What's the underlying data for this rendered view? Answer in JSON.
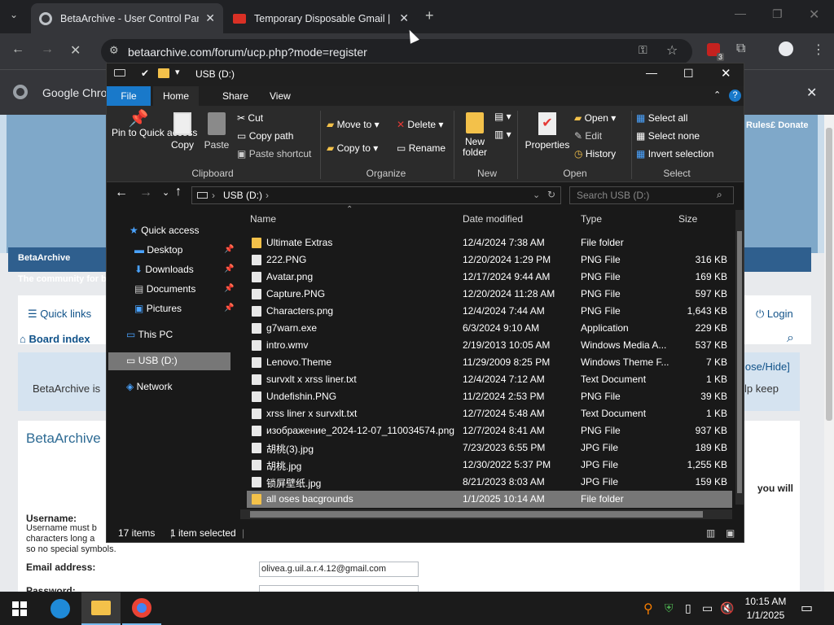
{
  "browser": {
    "tabs": [
      {
        "title": "BetaArchive - User Control Pan"
      },
      {
        "title": "Temporary Disposable Gmail | T"
      }
    ],
    "url": "betaarchive.com/forum/ucp.php?mode=register",
    "bookmark_bar": {
      "item": "Google Chrom"
    },
    "extension_badge": "3"
  },
  "webpage": {
    "nav_right": [
      "Rules",
      "Donate"
    ],
    "site_name": "BetaArchive",
    "tagline": "The community for be",
    "quick_links": "Quick links",
    "login": "Login",
    "board_index": "Board index",
    "notice_left": "BetaArchive is",
    "notice_right": "lp keep",
    "close_hide": "lose/Hide]",
    "section_title": "BetaArchive",
    "you_will": "you will",
    "username_label": "Username:",
    "username_help": [
      "Username must b",
      "characters long a",
      "so no special symbols."
    ],
    "email_label": "Email address:",
    "email_value": "olivea.g.uil.a.r.4.12@gmail.com",
    "password_label": "Password:"
  },
  "explorer": {
    "title": "USB (D:)",
    "ribbon_tabs": [
      "File",
      "Home",
      "Share",
      "View"
    ],
    "clipboard": {
      "pin": "Pin to Quick access",
      "copy": "Copy",
      "paste": "Paste",
      "cut": "Cut",
      "copy_path": "Copy path",
      "paste_shortcut": "Paste shortcut",
      "label": "Clipboard"
    },
    "organize": {
      "move_to": "Move to",
      "copy_to": "Copy to",
      "delete": "Delete",
      "rename": "Rename",
      "label": "Organize"
    },
    "new": {
      "new_folder": "New folder",
      "label": "New"
    },
    "open": {
      "properties": "Properties",
      "open": "Open",
      "edit": "Edit",
      "history": "History",
      "label": "Open"
    },
    "select": {
      "select_all": "Select all",
      "select_none": "Select none",
      "invert": "Invert selection",
      "label": "Select"
    },
    "address": "USB (D:)",
    "search_placeholder": "Search USB (D:)",
    "nav": {
      "quick_access": "Quick access",
      "desktop": "Desktop",
      "downloads": "Downloads",
      "documents": "Documents",
      "pictures": "Pictures",
      "this_pc": "This PC",
      "usb": "USB (D:)",
      "network": "Network"
    },
    "columns": {
      "name": "Name",
      "date": "Date modified",
      "type": "Type",
      "size": "Size"
    },
    "files": [
      {
        "name": "Ultimate Extras",
        "date": "12/4/2024 7:38 AM",
        "type": "File folder",
        "size": ""
      },
      {
        "name": "222.PNG",
        "date": "12/20/2024 1:29 PM",
        "type": "PNG File",
        "size": "316 KB"
      },
      {
        "name": "Avatar.png",
        "date": "12/17/2024 9:44 AM",
        "type": "PNG File",
        "size": "169 KB"
      },
      {
        "name": "Capture.PNG",
        "date": "12/20/2024 11:28 AM",
        "type": "PNG File",
        "size": "597 KB"
      },
      {
        "name": "Characters.png",
        "date": "12/4/2024 7:44 AM",
        "type": "PNG File",
        "size": "1,643 KB"
      },
      {
        "name": "g7warn.exe",
        "date": "6/3/2024 9:10 AM",
        "type": "Application",
        "size": "229 KB"
      },
      {
        "name": "intro.wmv",
        "date": "2/19/2013 10:05 AM",
        "type": "Windows Media A...",
        "size": "537 KB"
      },
      {
        "name": "Lenovo.Theme",
        "date": "11/29/2009 8:25 PM",
        "type": "Windows Theme F...",
        "size": "7 KB"
      },
      {
        "name": "survxlt x xrss liner.txt",
        "date": "12/4/2024 7:12 AM",
        "type": "Text Document",
        "size": "1 KB"
      },
      {
        "name": "Undefishin.PNG",
        "date": "11/2/2024 2:53 PM",
        "type": "PNG File",
        "size": "39 KB"
      },
      {
        "name": "xrss liner x survxlt.txt",
        "date": "12/7/2024 5:48 AM",
        "type": "Text Document",
        "size": "1 KB"
      },
      {
        "name": "изображение_2024-12-07_110034574.png",
        "date": "12/7/2024 8:41 AM",
        "type": "PNG File",
        "size": "937 KB"
      },
      {
        "name": "胡桃(3).jpg",
        "date": "7/23/2023 6:55 PM",
        "type": "JPG File",
        "size": "189 KB"
      },
      {
        "name": "胡桃.jpg",
        "date": "12/30/2022 5:37 PM",
        "type": "JPG File",
        "size": "1,255 KB"
      },
      {
        "name": "锁屏壁纸.jpg",
        "date": "8/21/2023 8:03 AM",
        "type": "JPG File",
        "size": "159 KB"
      },
      {
        "name": "all oses bacgrounds",
        "date": "1/1/2025 10:14 AM",
        "type": "File folder",
        "size": ""
      }
    ],
    "status": {
      "items": "17 items",
      "selected": "1 item selected"
    }
  },
  "taskbar": {
    "time": "10:15 AM",
    "date": "1/1/2025"
  }
}
